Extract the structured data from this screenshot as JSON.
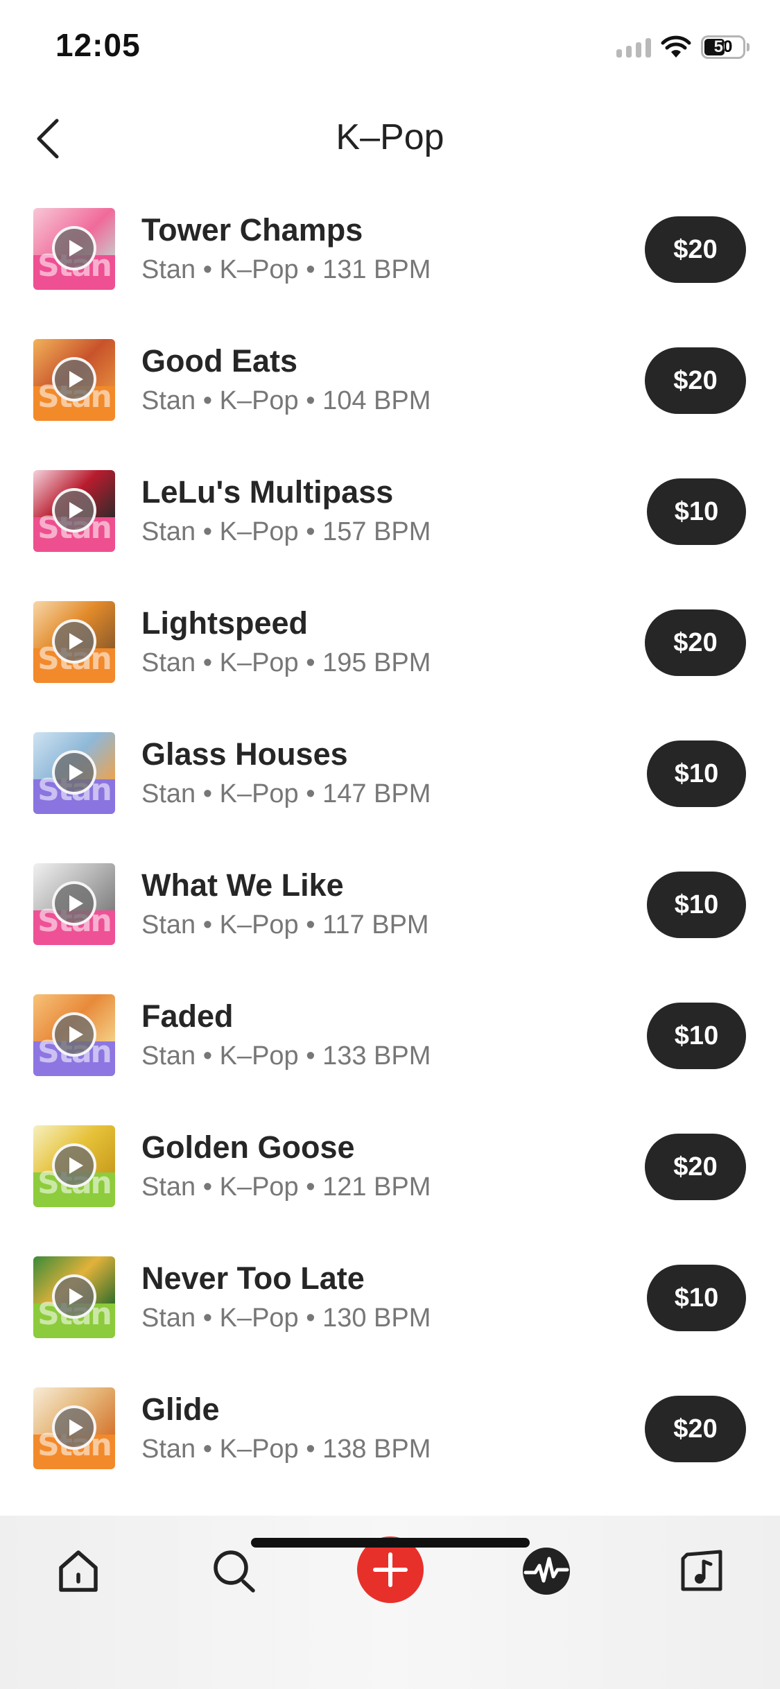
{
  "status_bar": {
    "time": "12:05",
    "battery": "50"
  },
  "header": {
    "title": "K–Pop"
  },
  "tracks": [
    {
      "title": "Tower Champs",
      "meta": "Stan • K–Pop • 131 BPM",
      "price": "$20"
    },
    {
      "title": "Good Eats",
      "meta": "Stan • K–Pop • 104 BPM",
      "price": "$20"
    },
    {
      "title": "LeLu's Multipass",
      "meta": "Stan • K–Pop • 157 BPM",
      "price": "$10"
    },
    {
      "title": "Lightspeed",
      "meta": "Stan • K–Pop • 195 BPM",
      "price": "$20"
    },
    {
      "title": "Glass Houses",
      "meta": "Stan • K–Pop • 147 BPM",
      "price": "$10"
    },
    {
      "title": "What We Like",
      "meta": "Stan • K–Pop • 117 BPM",
      "price": "$10"
    },
    {
      "title": "Faded",
      "meta": "Stan • K–Pop • 133 BPM",
      "price": "$10"
    },
    {
      "title": "Golden Goose",
      "meta": "Stan • K–Pop • 121 BPM",
      "price": "$20"
    },
    {
      "title": "Never Too Late",
      "meta": "Stan • K–Pop • 130 BPM",
      "price": "$10"
    },
    {
      "title": "Glide",
      "meta": "Stan • K–Pop • 138 BPM",
      "price": "$20"
    }
  ],
  "cover_art": {
    "text": "Stan"
  },
  "tab_bar": {
    "items": [
      "home-icon",
      "search-icon",
      "create-icon",
      "waveform-icon",
      "library-icon"
    ],
    "accent": "#e8302a"
  },
  "colors": {
    "price_button": "#262626",
    "meta_text": "#777777"
  }
}
